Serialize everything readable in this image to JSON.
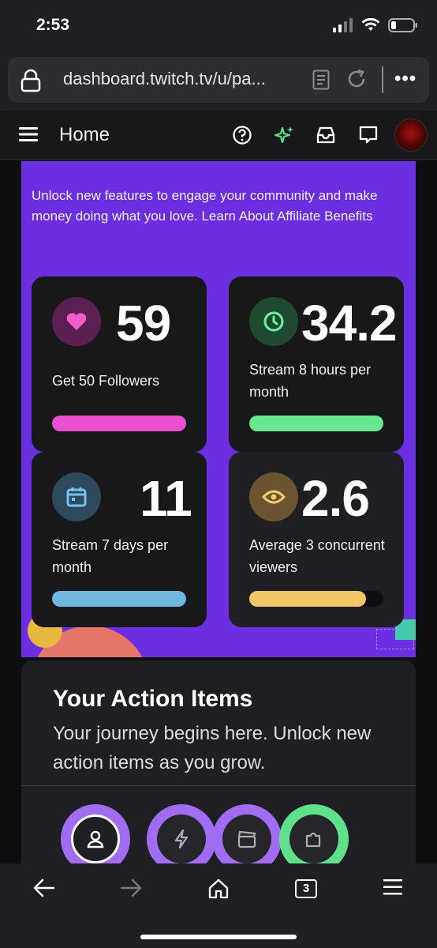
{
  "status": {
    "time": "2:53"
  },
  "browser": {
    "url": "dashboard.twitch.tv/u/pa...",
    "more_label": "•••"
  },
  "header": {
    "title": "Home"
  },
  "intro": {
    "text": "Unlock new features to engage your community and make money doing what you love. Learn About Affiliate Benefits"
  },
  "stats": [
    {
      "value": "59",
      "label": "Get 50 Followers",
      "progress": 1.0,
      "color": "#e94fcf",
      "icon": "heart-icon"
    },
    {
      "value": "34.2",
      "label": "Stream 8 hours per month",
      "progress": 1.0,
      "color": "#68e891",
      "icon": "clock-icon"
    },
    {
      "value": "11",
      "label": "Stream 7 days per month",
      "progress": 1.0,
      "color": "#6fb6e0",
      "icon": "calendar-icon"
    },
    {
      "value": "2.6",
      "label": "Average 3 concurrent viewers",
      "progress": 0.87,
      "color": "#f2c666",
      "icon": "eye-icon"
    }
  ],
  "action_items": {
    "title": "Your Action Items",
    "subtitle": "Your journey begins here. Unlock new action items as you grow.",
    "badges": [
      {
        "icon": "user-icon",
        "ring": "#9f6cf2"
      },
      {
        "icon": "bolt-icon",
        "ring": "#9f6cf2"
      },
      {
        "icon": "clapper-icon",
        "ring": "#9f6cf2"
      },
      {
        "icon": "puzzle-icon",
        "ring": "#5fe08a"
      }
    ]
  },
  "toolbar": {
    "tab_count": "3"
  },
  "colors": {
    "purple": "#6b2ee0",
    "card": "#18181b",
    "accent_green": "#5fe08a"
  }
}
